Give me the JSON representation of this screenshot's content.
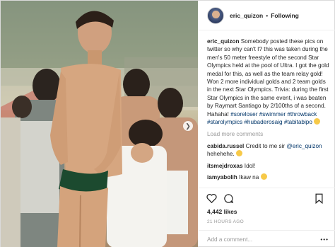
{
  "header": {
    "username": "eric_quizon",
    "separator": "•",
    "follow_label": "Following"
  },
  "caption": {
    "username": "eric_quizon",
    "text": " Somebody posted these pics on twitter so why can't I?  this was taken during the men's 50 meter freestyle of the second Star Olympics held at the pool of Ultra. I got the gold medal for this, as well as the team relay gold! Won 2 more individual golds and 2 team golds in the next Star Olympics. Trivia: during the first Star Olympics in the same event, i was beaten by Raymart Santiago by 2/100ths of a second. Hahaha! ",
    "hashtags": [
      "#soreloser",
      "#swimmer",
      "#throwback",
      "#starolympics",
      "#hubaderosaig",
      "#tabitabipo"
    ]
  },
  "load_more_label": "Load more comments",
  "comments": [
    {
      "username": "cabida.russel",
      "text": " Credit to me sir ",
      "mention": "@eric_quizon",
      "text2": " hehehehe. ",
      "emoji": "laughing-emoji"
    },
    {
      "username": "itsmejdroxas",
      "text": " Idol!",
      "mention": "",
      "text2": "",
      "emoji": ""
    },
    {
      "username": "iamyabolih",
      "text": " Ikaw na ",
      "mention": "",
      "text2": "",
      "emoji": "grin-emoji"
    }
  ],
  "likes": "4,442 likes",
  "timestamp": "21 HOURS AGO",
  "add_comment_placeholder": "Add a comment...",
  "colors": {
    "link": "#003569",
    "muted": "#999999",
    "text": "#262626",
    "border": "#efefef"
  },
  "icons": [
    "heart-icon",
    "comment-icon",
    "bookmark-icon",
    "more-options-icon",
    "chevron-right-icon"
  ]
}
